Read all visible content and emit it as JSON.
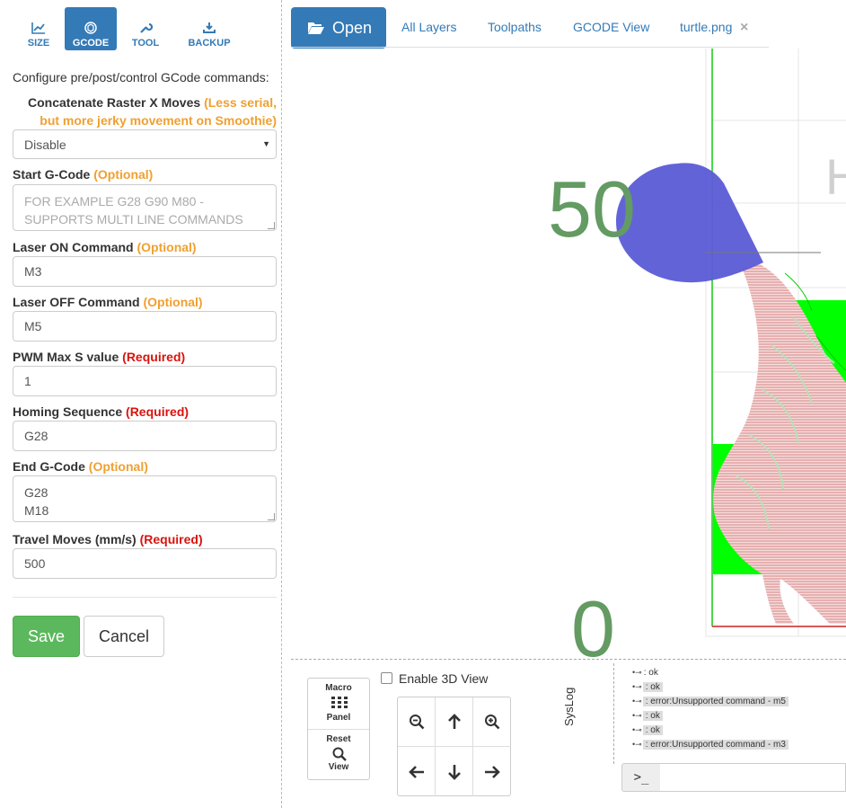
{
  "tabs": [
    {
      "label": "SIZE",
      "icon": "chart-icon"
    },
    {
      "label": "GCODE",
      "icon": "cube-icon",
      "active": true
    },
    {
      "label": "TOOL",
      "icon": "wrench-icon"
    },
    {
      "label": "BACKUP",
      "icon": "download-icon"
    }
  ],
  "settings": {
    "intro": "Configure pre/post/control GCode commands:",
    "concat_label": "Concatenate Raster X Moves",
    "concat_note": "(Less serial, but more jerky movement on Smoothie)",
    "concat_value": "Disable",
    "start_label": "Start G-Code",
    "start_tag": "(Optional)",
    "start_placeholder_1": "FOR EXAMPLE G28 G90 M80 -",
    "start_placeholder_2": "SUPPORTS MULTI LINE COMMANDS",
    "laser_on_label": "Laser ON Command",
    "laser_on_tag": "(Optional)",
    "laser_on_value": "M3",
    "laser_off_label": "Laser OFF Command",
    "laser_off_tag": "(Optional)",
    "laser_off_value": "M5",
    "pwm_label": "PWM Max S value",
    "pwm_tag": "(Required)",
    "pwm_value": "1",
    "homing_label": "Homing Sequence",
    "homing_tag": "(Required)",
    "homing_value": "G28",
    "end_label": "End G-Code",
    "end_tag": "(Optional)",
    "end_value_1": "G28",
    "end_value_2": "M18",
    "travel_label": "Travel Moves (mm/s)",
    "travel_tag": "(Required)",
    "travel_value": "500",
    "save_label": "Save",
    "cancel_label": "Cancel"
  },
  "toolbar": {
    "open_label": "Open",
    "tabs": [
      "All Layers",
      "Toolpaths",
      "GCODE View",
      "turtle.png"
    ],
    "close_glyph": "×"
  },
  "viewport": {
    "axis_label_50": "50",
    "axis_label_0": "0",
    "cut_letter": "H"
  },
  "controls": {
    "macro_label_1": "Macro",
    "macro_label_2": "Panel",
    "reset_label_1": "Reset",
    "reset_label_2": "View",
    "enable_3d_label": "Enable 3D View",
    "syslog_label": "SysLog",
    "terminal_prompt": ">_"
  },
  "log": [
    {
      "text": ": ok",
      "highlight": false
    },
    {
      "text": ": ok",
      "highlight": true
    },
    {
      "text": ": error:Unsupported command - m5",
      "highlight": true
    },
    {
      "text": ": ok",
      "highlight": true
    },
    {
      "text": ": ok",
      "highlight": true
    },
    {
      "text": ": error:Unsupported command - m3",
      "highlight": true
    }
  ],
  "colors": {
    "primary": "#337ab7",
    "success": "#5cb85c",
    "optional": "#f0a030",
    "required": "#d9130d",
    "axis_text": "#639b63",
    "gcode_fill": "#00ff00",
    "raster": "#e8b4b4",
    "laser_head": "#5b5bd6"
  }
}
